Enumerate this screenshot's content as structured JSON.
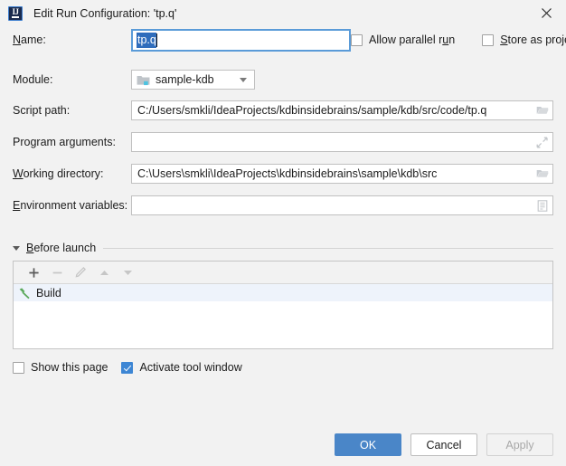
{
  "window": {
    "title": "Edit Run Configuration: 'tp.q'",
    "app_icon": "intellij-idea-icon",
    "close_icon": "close-icon"
  },
  "form": {
    "name": {
      "label": "Name:",
      "mnemonic": "N",
      "value": "tp.q",
      "selected": true
    },
    "allow_parallel_run": {
      "label": "Allow parallel run",
      "checked": false
    },
    "store_as_project_file": {
      "label": "Store as project file",
      "checked": false,
      "gear_icon": "gear-icon",
      "gear_disabled": true
    },
    "module": {
      "label": "Module:",
      "value": "sample-kdb",
      "icon": "module-folder-icon"
    },
    "script_path": {
      "label": "Script path:",
      "value": "C:/Users/smkli/IdeaProjects/kdbinsidebrains/sample/kdb/src/code/tp.q",
      "button_icon": "folder-open-icon"
    },
    "program_arguments": {
      "label": "Program arguments:",
      "value": "",
      "button_icon": "expand-icon"
    },
    "working_directory": {
      "label": "Working directory:",
      "value": "C:\\Users\\smkli\\IdeaProjects\\kdbinsidebrains\\sample\\kdb\\src",
      "button_icon": "folder-open-icon"
    },
    "environment_variables": {
      "label": "Environment variables:",
      "value": "",
      "button_icon": "list-edit-icon"
    }
  },
  "before_launch": {
    "title": "Before launch",
    "expanded": true,
    "toolbar": [
      {
        "name": "add-button",
        "icon": "plus-icon",
        "enabled": true
      },
      {
        "name": "remove-button",
        "icon": "minus-icon",
        "enabled": false
      },
      {
        "name": "edit-button",
        "icon": "pencil-icon",
        "enabled": false
      },
      {
        "name": "move-up-button",
        "icon": "arrow-up-icon",
        "enabled": false
      },
      {
        "name": "move-down-button",
        "icon": "arrow-down-icon",
        "enabled": false
      }
    ],
    "items": [
      {
        "label": "Build",
        "icon": "hammer-icon",
        "selected": true
      }
    ]
  },
  "bottom": {
    "show_this_page": {
      "label": "Show this page",
      "checked": false
    },
    "activate_tool_window": {
      "label": "Activate tool window",
      "checked": true
    },
    "ok_label": "OK",
    "cancel_label": "Cancel",
    "apply_label": "Apply",
    "apply_enabled": false
  },
  "colors": {
    "background": "#f2f2f2",
    "accent": "#4a86c8",
    "focus_border": "#5a9bd8",
    "selection": "#2f6dbc",
    "row_selection": "#eef3fb",
    "build_icon": "#5aa85a"
  }
}
